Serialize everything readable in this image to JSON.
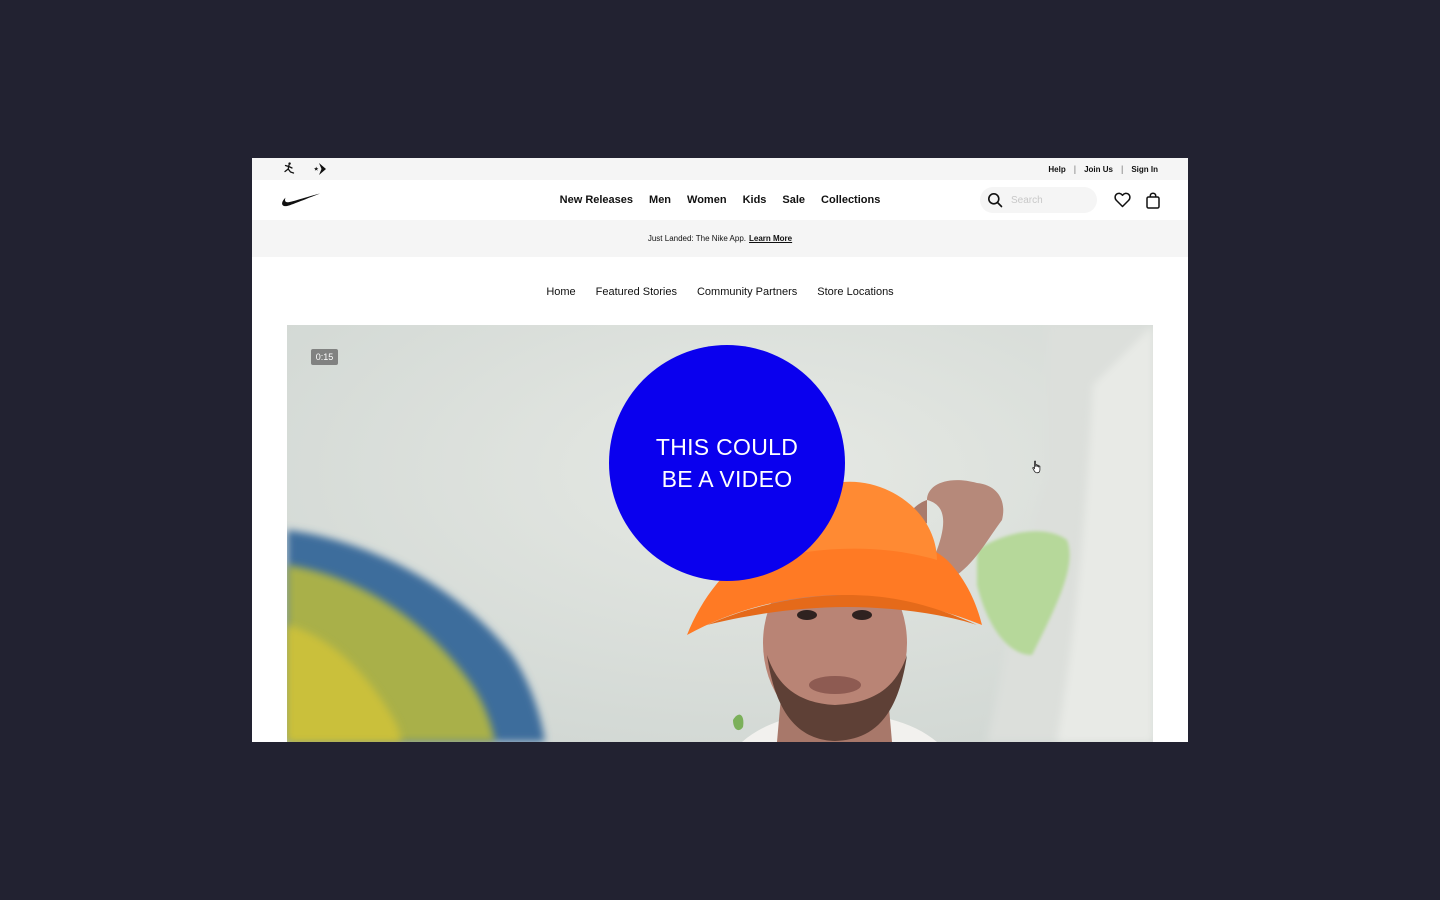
{
  "utility_bar": {
    "brand_icons": [
      "jordan-jumpman-icon",
      "converse-star-chevron-icon"
    ],
    "links": [
      "Help",
      "Join Us",
      "Sign In"
    ]
  },
  "header": {
    "logo": "nike-swoosh-logo",
    "nav": [
      "New Releases",
      "Men",
      "Women",
      "Kids",
      "Sale",
      "Collections"
    ],
    "search_placeholder": "Search",
    "icons": [
      "search-icon",
      "heart-icon",
      "bag-icon"
    ]
  },
  "promo": {
    "text": "Just Landed: The Nike App.",
    "link": "Learn More"
  },
  "sub_nav": [
    "Home",
    "Featured Stories",
    "Community Partners",
    "Store Locations"
  ],
  "video": {
    "timestamp": "0:15",
    "overlay_line1": "THIS COULD",
    "overlay_line2": "BE A VIDEO",
    "overlay_color": "#0a00ee"
  }
}
